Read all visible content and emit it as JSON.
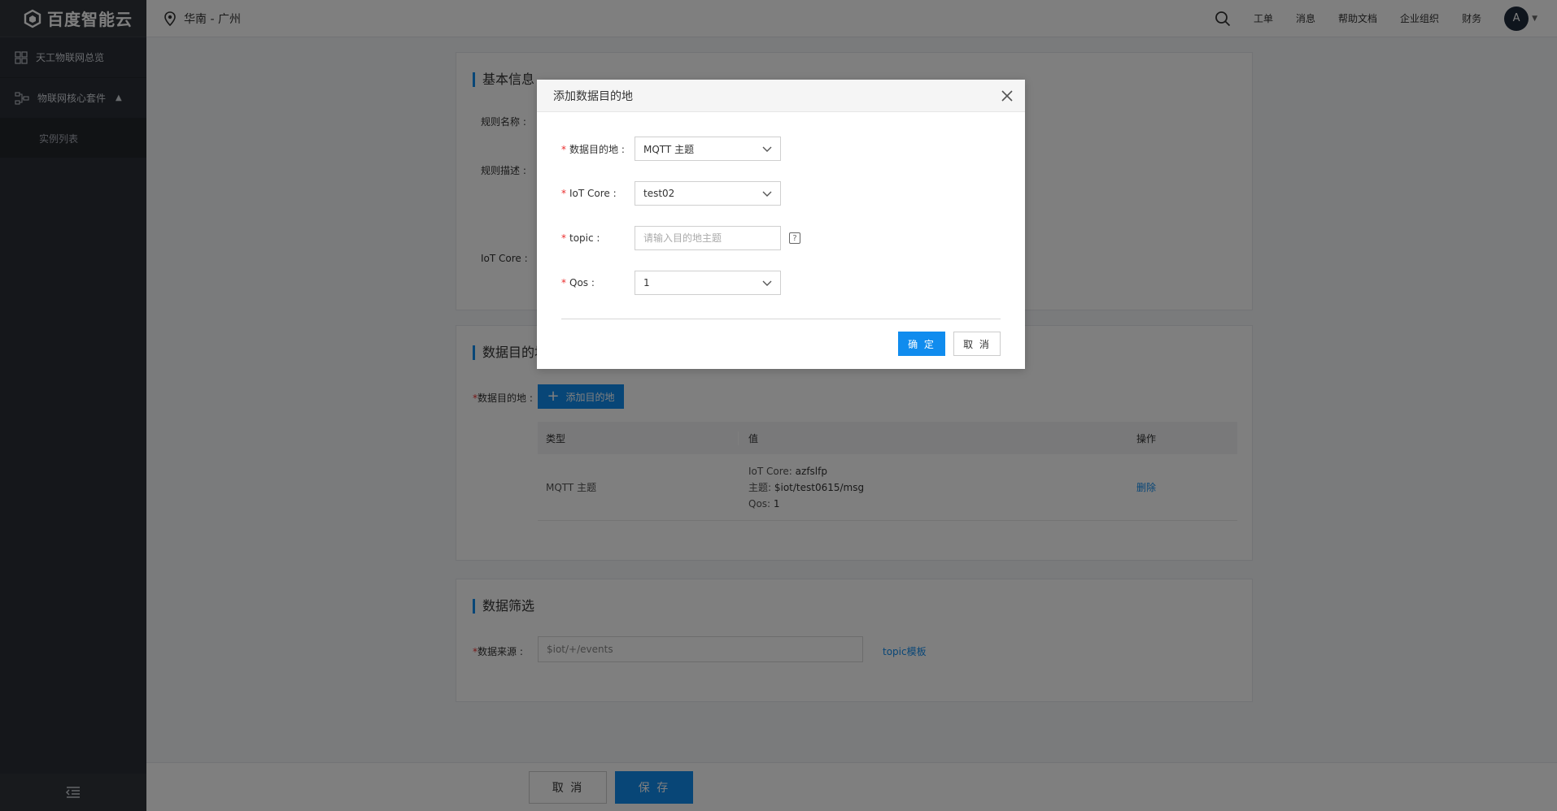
{
  "brand": {
    "name": "百度智能云"
  },
  "sidebar": {
    "items": [
      {
        "label": "天工物联网总览",
        "icon": "grid-icon"
      },
      {
        "label": "物联网核心套件",
        "icon": "modules-icon"
      }
    ],
    "sub_items": [
      {
        "label": "实例列表"
      }
    ]
  },
  "topbar": {
    "region": "华南 - 广州",
    "nav": [
      "工单",
      "消息",
      "帮助文档",
      "企业组织",
      "财务"
    ],
    "avatar": "A"
  },
  "basic_info": {
    "title": "基本信息",
    "fields": [
      "规则名称 :",
      "规则描述 :",
      "IoT Core :"
    ]
  },
  "destination": {
    "title": "数据目的地",
    "label": "数据目的地 :",
    "add_button": "添加目的地",
    "table": {
      "headers": [
        "类型",
        "值",
        "操作"
      ],
      "rows": [
        {
          "type": "MQTT 主题",
          "values": [
            {
              "k": "IoT Core:",
              "v": "azfslfp"
            },
            {
              "k": "主题:",
              "v": "$iot/test0615/msg"
            },
            {
              "k": "Qos:",
              "v": "1"
            }
          ],
          "action": "删除"
        }
      ]
    }
  },
  "filter": {
    "title": "数据筛选",
    "label": "数据来源 :",
    "source_value": "$iot/+/events",
    "topic_link": "topic模板"
  },
  "footer": {
    "cancel": "取 消",
    "save": "保 存"
  },
  "dialog": {
    "title": "添加数据目的地",
    "fields": {
      "dest_label": "数据目的地 :",
      "dest_value": "MQTT 主题",
      "iot_label": "IoT Core :",
      "iot_value": "test02",
      "topic_label": "topic :",
      "topic_placeholder": "请输入目的地主题",
      "qos_label": "Qos :",
      "qos_value": "1"
    },
    "help": "?",
    "ok": "确 定",
    "cancel": "取 消"
  },
  "colors": {
    "primary": "#108cee",
    "sidebar": "#2b2f36",
    "required": "#ea2e2e"
  }
}
